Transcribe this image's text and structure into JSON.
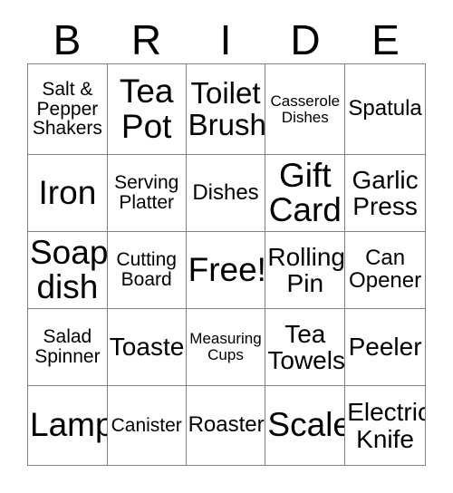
{
  "card": {
    "title_letters": [
      "B",
      "R",
      "I",
      "D",
      "E"
    ],
    "free_space_label": "Free!",
    "grid": [
      [
        {
          "label": "Salt & Pepper Shakers",
          "size": "fs-s"
        },
        {
          "label": "Tea Pot",
          "size": "fs-xxl"
        },
        {
          "label": "Toilet Brush",
          "size": "fs-xl"
        },
        {
          "label": "Casserole Dishes",
          "size": "fs-xs"
        },
        {
          "label": "Spatula",
          "size": "fs-m"
        }
      ],
      [
        {
          "label": "Iron",
          "size": "fs-xxl"
        },
        {
          "label": "Serving Platter",
          "size": "fs-s"
        },
        {
          "label": "Dishes",
          "size": "fs-m"
        },
        {
          "label": "Gift Card",
          "size": "fs-xxl"
        },
        {
          "label": "Garlic Press",
          "size": "fs-l"
        }
      ],
      [
        {
          "label": "Soap dish",
          "size": "fs-xxl"
        },
        {
          "label": "Cutting Board",
          "size": "fs-s"
        },
        {
          "label": "Free!",
          "size": "fs-xxl"
        },
        {
          "label": "Rolling Pin",
          "size": "fs-l"
        },
        {
          "label": "Can Opener",
          "size": "fs-m"
        }
      ],
      [
        {
          "label": "Salad Spinner",
          "size": "fs-s"
        },
        {
          "label": "Toaster",
          "size": "fs-l"
        },
        {
          "label": "Measuring Cups",
          "size": "fs-xs"
        },
        {
          "label": "Tea Towels",
          "size": "fs-l"
        },
        {
          "label": "Peeler",
          "size": "fs-l"
        }
      ],
      [
        {
          "label": "Lamp",
          "size": "fs-xxl"
        },
        {
          "label": "Canister",
          "size": "fs-s"
        },
        {
          "label": "Roaster",
          "size": "fs-m"
        },
        {
          "label": "Scale",
          "size": "fs-xxl"
        },
        {
          "label": "Electric Knife",
          "size": "fs-l"
        }
      ]
    ]
  },
  "colors": {
    "background": "#ffffff",
    "text": "#000000",
    "grid_line": "#808080"
  }
}
